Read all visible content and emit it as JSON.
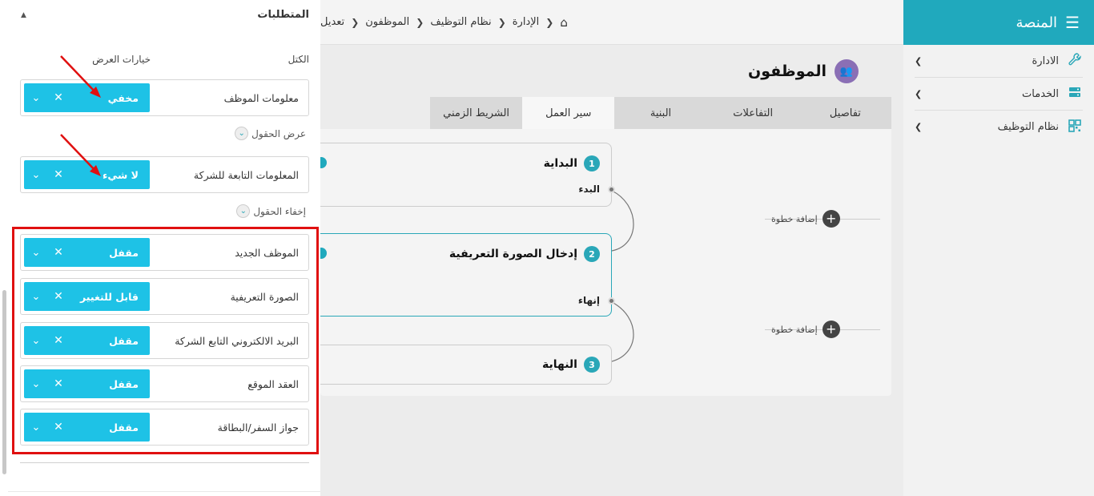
{
  "sidebar": {
    "title": "المنصة",
    "items": [
      {
        "label": "الادارة",
        "icon": "wrench-icon"
      },
      {
        "label": "الخدمات",
        "icon": "server-icon"
      },
      {
        "label": "نظام التوظيف",
        "icon": "qrcode-icon"
      }
    ]
  },
  "breadcrumb": [
    "الإدارة",
    "نظام التوظيف",
    "الموظفون",
    "تعديل"
  ],
  "page": {
    "title": "الموظفون"
  },
  "tabs": [
    "تفاصيل",
    "التفاعلات",
    "البنية",
    "سير العمل",
    "الشريط الزمني"
  ],
  "active_tab": "سير العمل",
  "workflow": {
    "steps": [
      {
        "num": "1",
        "name": "البداية",
        "action": "البدء"
      },
      {
        "num": "2",
        "name": "إدخال الصورة التعريفية",
        "action": "إنهاء"
      },
      {
        "num": "3",
        "name": "النهاية",
        "action": ""
      }
    ],
    "add_step_label": "إضافة خطوة"
  },
  "requirements": {
    "title": "المتطلبات",
    "col_blocks": "الكتل",
    "col_display": "خيارات العرض",
    "show_fields": "عرض الحقول",
    "hide_fields": "إخفاء الحقول",
    "blocks": [
      {
        "name": "معلومات الموظف",
        "value": "مخفي"
      },
      {
        "name": "المعلومات التابعة للشركة",
        "value": "لا شيء"
      }
    ],
    "fields": [
      {
        "name": "الموظف الجديد",
        "value": "مقفل"
      },
      {
        "name": "الصورة التعريفية",
        "value": "قابل للتغيير"
      },
      {
        "name": "البريد الالكتروني التابع الشركة",
        "value": "مقفل"
      },
      {
        "name": "العقد الموقع",
        "value": "مقفل"
      },
      {
        "name": "جواز السفر/البطاقة",
        "value": "مقفل"
      }
    ]
  },
  "colors": {
    "accent": "#20a9bd",
    "select": "#1ec2e6",
    "highlight": "#e01010",
    "badge": "#8a6fb5"
  }
}
